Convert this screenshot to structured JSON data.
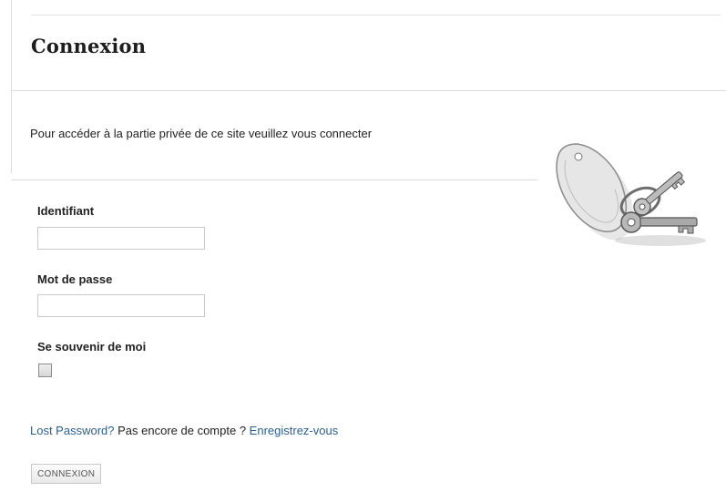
{
  "page": {
    "title": "Connexion",
    "intro": "Pour accéder à la partie privée de ce site veuillez vous connecter"
  },
  "form": {
    "username_label": "Identifiant",
    "username_value": "",
    "password_label": "Mot de passe",
    "password_value": "",
    "remember_label": "Se souvenir de moi",
    "remember_checked": false,
    "submit_label": "CONNEXION"
  },
  "links": {
    "lost_password": "Lost Password?",
    "no_account": "Pas encore de compte ?",
    "register": "Enregistrez-vous"
  },
  "decor": {
    "image_icon": "keys-with-tag-icon"
  },
  "colors": {
    "link": "#2b5f8e",
    "text": "#222222",
    "rule": "#dcdcdc"
  }
}
